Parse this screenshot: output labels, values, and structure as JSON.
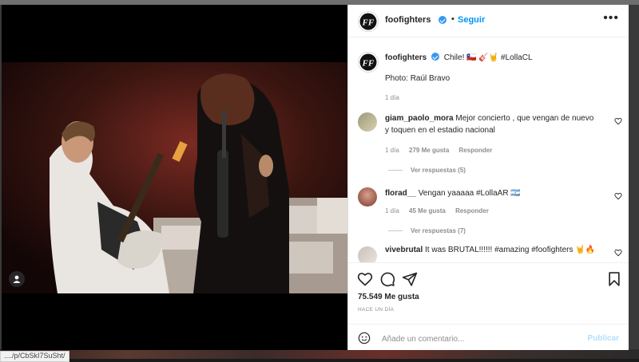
{
  "status_url": "..../p/CbSkI7SuSht/",
  "post": {
    "username": "foofighters",
    "follow_label": "Seguir",
    "more_label": "•••",
    "dot": "•",
    "caption": {
      "text": "Chile! 🇨🇱 🎸🤘 #LollaCL",
      "photo_credit": "Photo: Raúl Bravo",
      "age": "1 día"
    },
    "comments": [
      {
        "user": "giam_paolo_mora",
        "text": "Mejor concierto , que vengan de nuevo y toquen en el estadio nacional",
        "age": "1 día",
        "likes": "279 Me gusta",
        "reply_label": "Responder",
        "view_replies": "Ver respuestas (5)"
      },
      {
        "user": "florad__",
        "text": "Vengan yaaaaa #LollaAR 🇦🇷",
        "age": "1 día",
        "likes": "45 Me gusta",
        "reply_label": "Responder",
        "view_replies": "Ver respuestas (7)"
      },
      {
        "user": "vivebrutal",
        "text": "It was BRUTAL!!!!!! #amazing #foofighters 🤘🔥"
      }
    ],
    "likes_count": "75.549 Me gusta",
    "posted_when": "HACE UN DÍA",
    "comment_placeholder": "Añade un comentario...",
    "publish_label": "Publicar"
  },
  "colors": {
    "accent": "#0095f6",
    "verified": "#3897f0",
    "muted": "#8e8e8e",
    "text": "#262626"
  },
  "icons": [
    "more-options-icon",
    "verified-icon",
    "heart-icon",
    "comment-icon",
    "share-icon",
    "bookmark-icon",
    "emoji-icon",
    "user-tag-icon",
    "ff-logo-icon"
  ]
}
